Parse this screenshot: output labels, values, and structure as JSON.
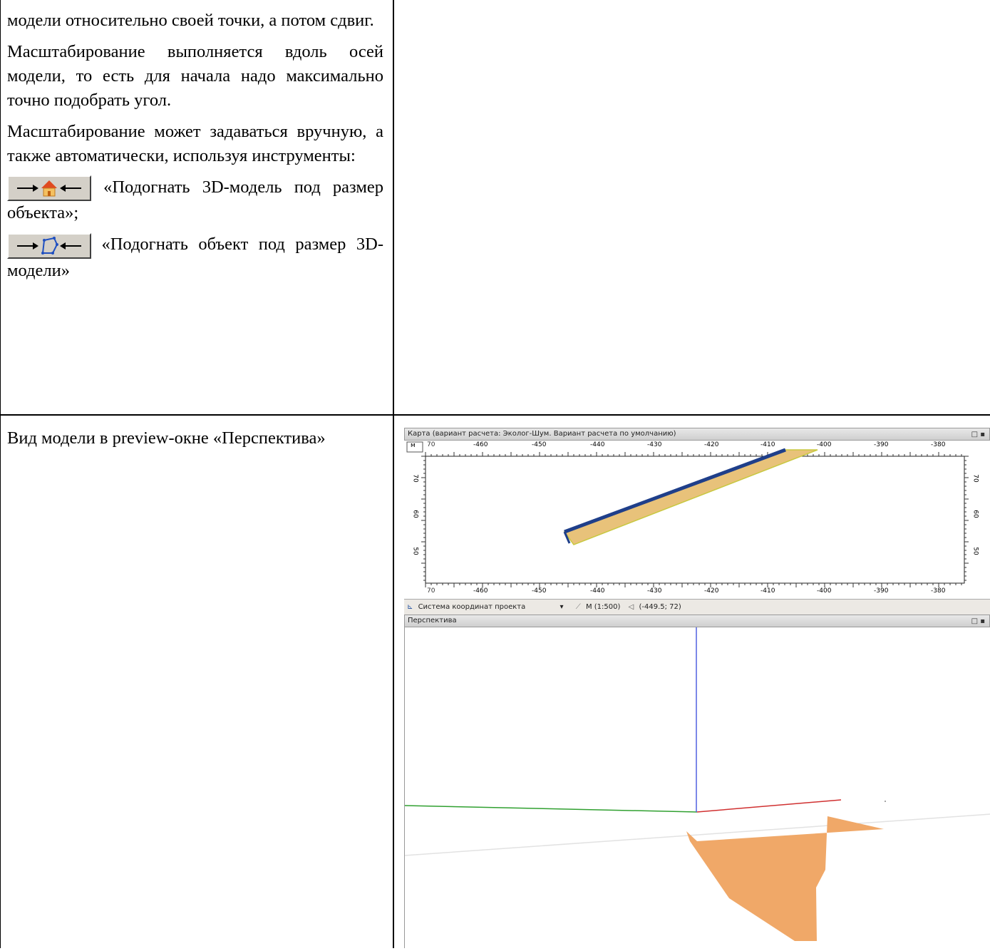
{
  "left_top": {
    "p1": "модели относительно своей точки, а потом сдвиг.",
    "p2": "Масштабирование выполняется вдоль осей модели, то есть для начала надо максимально точно подобрать угол.",
    "p3": "Масштабирование может задаваться вручную, а также автоматически, используя инструменты:",
    "tool1_text": "«Подогнать 3D-модель под размер объекта»;",
    "tool2_text": "«Подогнать объект под размер 3D-модели»"
  },
  "left_bottom": {
    "caption": "Вид модели в preview-окне «Перспектива»"
  },
  "map_window": {
    "title": "Карта (вариант расчета: Эколог-Шум. Вариант расчета по умолчанию)",
    "corner_label": "м",
    "x_ticks": [
      "-460",
      "-450",
      "-440",
      "-430",
      "-420",
      "-410",
      "-400",
      "-390",
      "-380"
    ],
    "x_ticks_first": "70",
    "y_ticks": [
      "70",
      "60",
      "50"
    ],
    "status_coord_system": "Система координат проекта",
    "status_scale": "М (1:500)",
    "status_cursor": "(-449.5; 72)"
  },
  "perspective_window": {
    "title": "Перспектива"
  },
  "colors": {
    "map_bar_fill": "#e8c27a",
    "map_bar_edge": "#1f3f8a",
    "model_fill": "#f0a868",
    "axis_x": "#d03030",
    "axis_y": "#30a030",
    "axis_z": "#3040d0"
  },
  "icons": [
    "fit-model-to-object-icon",
    "fit-object-to-model-icon",
    "window-restore-icon",
    "window-close-icon",
    "coordinate-system-icon",
    "dropdown-arrow-icon",
    "scale-icon",
    "cursor-coords-icon"
  ]
}
